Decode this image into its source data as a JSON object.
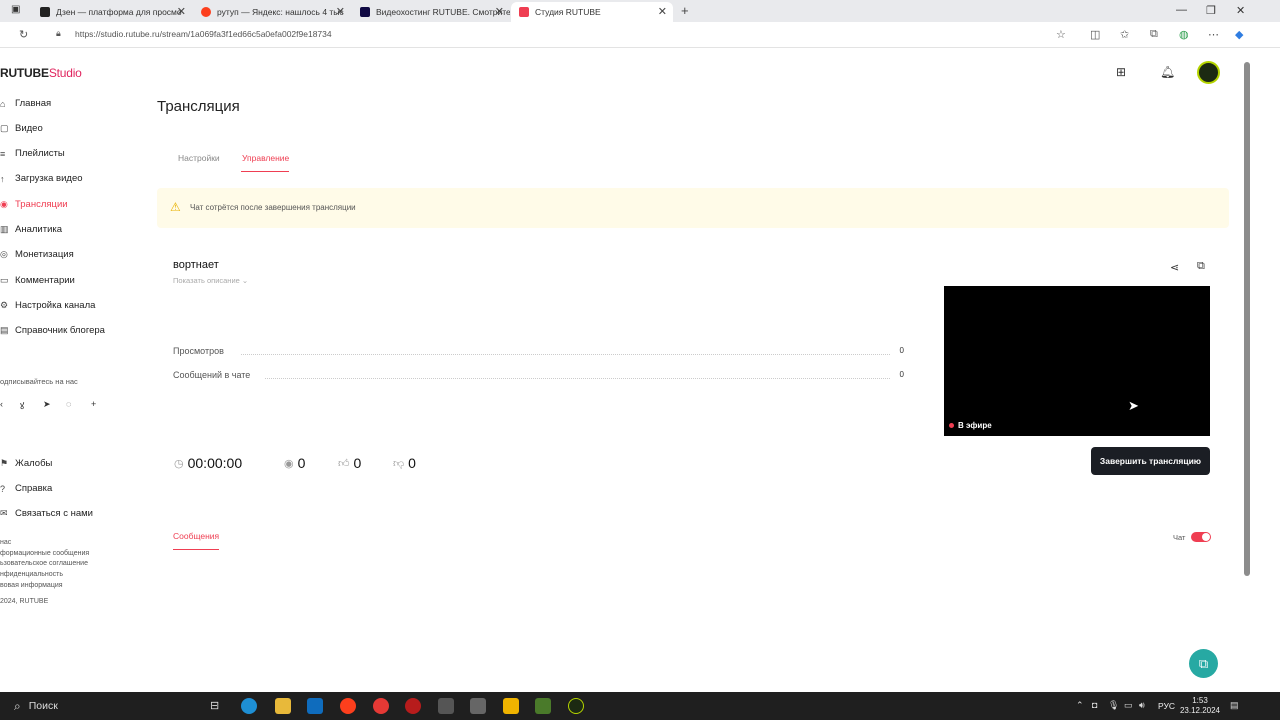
{
  "browser": {
    "tabs": [
      {
        "title": "Дзен — платформа для просмо",
        "favicon_color": "#222222"
      },
      {
        "title": "рутуп — Яндекс: нашлось 4 тыс",
        "favicon_color": "#fc3f1d"
      },
      {
        "title": "Видеохостинг RUTUBE. Смотрите",
        "favicon_color": "#100943"
      },
      {
        "title": "Студия RUTUBE",
        "favicon_color": "#ef3e52"
      }
    ],
    "url": "https://studio.rutube.ru/stream/1a069fa3f1ed66c5a0efa002f9e18734"
  },
  "logo": {
    "main": "RUTUBE",
    "studio": "Studio"
  },
  "sidebar": {
    "items": [
      {
        "label": "Главная",
        "icon": "home-icon"
      },
      {
        "label": "Видео",
        "icon": "video-icon"
      },
      {
        "label": "Плейлисты",
        "icon": "playlist-icon"
      },
      {
        "label": "Загрузка видео",
        "icon": "upload-icon"
      },
      {
        "label": "Трансляции",
        "icon": "broadcast-icon",
        "active": true
      },
      {
        "label": "Аналитика",
        "icon": "analytics-icon"
      },
      {
        "label": "Монетизация",
        "icon": "monetization-icon"
      },
      {
        "label": "Комментарии",
        "icon": "comments-icon"
      },
      {
        "label": "Настройка канала",
        "icon": "settings-icon"
      },
      {
        "label": "Справочник блогера",
        "icon": "book-icon"
      }
    ],
    "subscribe_label": "одписывайтесь на нас",
    "secondary_items": [
      {
        "label": "Жалобы",
        "icon": "flag-icon"
      },
      {
        "label": "Справка",
        "icon": "help-icon"
      },
      {
        "label": "Связаться с нами",
        "icon": "contact-icon"
      }
    ],
    "footer": [
      "нас",
      "формационные сообщения",
      "ьзовательское соглашение",
      "нфиденциальность",
      "вовая информация",
      "2024, RUTUBE"
    ]
  },
  "page": {
    "title": "Трансляция",
    "tabs": [
      "Настройки",
      "Управление"
    ],
    "active_tab": "Управление",
    "warning": "Чат сотрётся после завершения трансляции",
    "stream_name": "вортнает",
    "show_description": "Показать описание",
    "stats": [
      {
        "label": "Просмотров",
        "value": "0"
      },
      {
        "label": "Сообщений в чате",
        "value": "0"
      }
    ],
    "live_badge": "В эфире",
    "counters": {
      "duration": "00:00:00",
      "viewers": "0",
      "likes": "0",
      "dislikes": "0"
    },
    "end_button": "Завершить трансляцию",
    "messages_tab": "Сообщения",
    "chat_label": "Чат",
    "chat_enabled": true
  },
  "colors": {
    "accent": "#ef3e52",
    "warning_bg": "#fffbe8",
    "button_dark": "#1b1e24"
  },
  "taskbar": {
    "search_placeholder": "Поиск",
    "lang": "РУС",
    "time": "1:53",
    "date": "23.12.2024"
  }
}
